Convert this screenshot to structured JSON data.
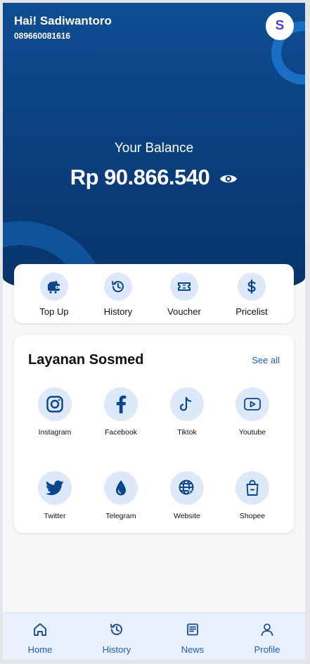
{
  "header": {
    "greeting": "Hai! Sadiwantoro",
    "phone": "089660081616",
    "avatar_initial": "S"
  },
  "balance": {
    "label": "Your Balance",
    "amount": "Rp 90.866.540",
    "toggle_icon": "eye-icon"
  },
  "quick_actions": [
    {
      "label": "Top Up",
      "icon": "wallet-icon"
    },
    {
      "label": "History",
      "icon": "history-icon"
    },
    {
      "label": "Voucher",
      "icon": "ticket-icon"
    },
    {
      "label": "Pricelist",
      "icon": "dollar-icon"
    }
  ],
  "sosmed": {
    "title": "Layanan Sosmed",
    "see_all": "See all",
    "items": [
      {
        "label": "Instagram",
        "icon": "instagram-icon"
      },
      {
        "label": "Facebook",
        "icon": "facebook-icon"
      },
      {
        "label": "Tiktok",
        "icon": "tiktok-icon"
      },
      {
        "label": "Youtube",
        "icon": "youtube-icon"
      },
      {
        "label": "Twitter",
        "icon": "twitter-icon"
      },
      {
        "label": "Telegram",
        "icon": "telegram-icon"
      },
      {
        "label": "Website",
        "icon": "globe-icon"
      },
      {
        "label": "Shopee",
        "icon": "shopping-bag-icon"
      }
    ]
  },
  "nav": [
    {
      "label": "Home",
      "icon": "home-icon"
    },
    {
      "label": "History",
      "icon": "history-icon"
    },
    {
      "label": "News",
      "icon": "newspaper-icon"
    },
    {
      "label": "Profile",
      "icon": "user-icon"
    }
  ],
  "colors": {
    "primary": "#0c468a",
    "accent": "#1f5fb8",
    "icon_bg": "#dde9f8",
    "avatar_text": "#4a3fd1"
  }
}
